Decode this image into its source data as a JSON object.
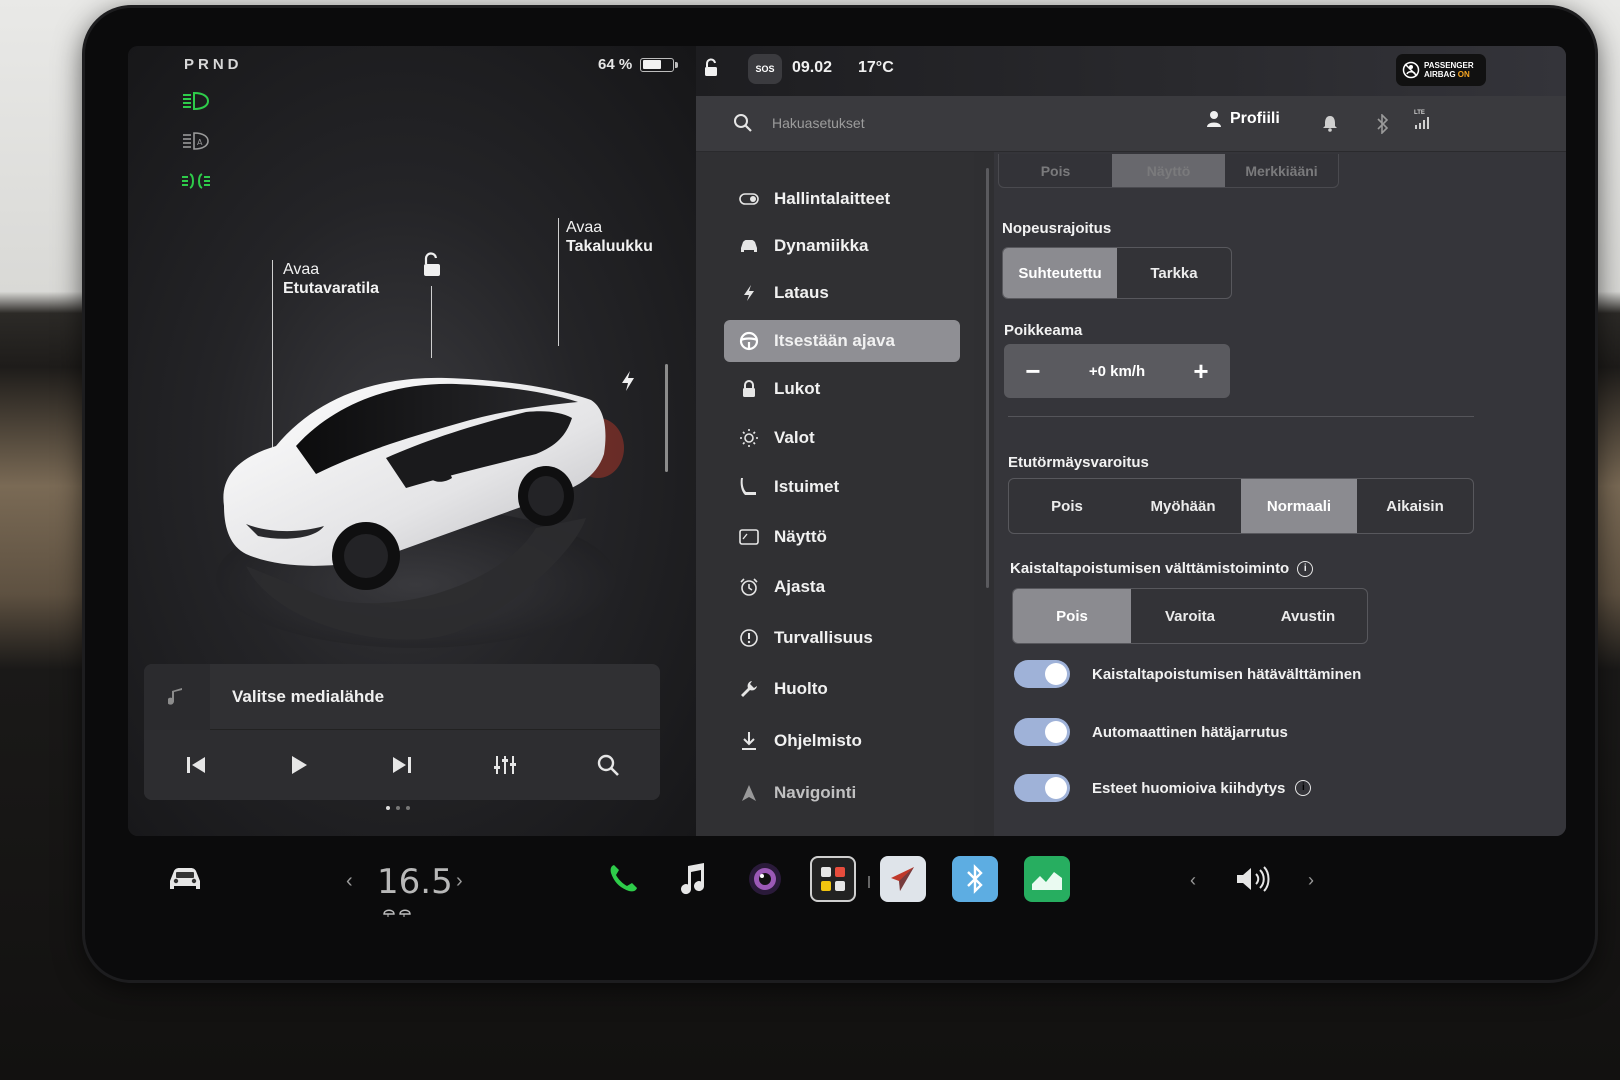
{
  "drive": {
    "gears": "PRND"
  },
  "battery": {
    "percent_label": "64 %",
    "level": 0.64
  },
  "callouts": {
    "front_trunk_line1": "Avaa",
    "front_trunk_line2": "Etutavaratila",
    "rear_trunk_line1": "Avaa",
    "rear_trunk_line2": "Takaluukku"
  },
  "media": {
    "source_label": "Valitse medialähde"
  },
  "status_bar": {
    "sos": "SOS",
    "time": "09.02",
    "temperature": "17°C",
    "airbag_line1": "PASSENGER",
    "airbag_line2_prefix": "AIRBAG",
    "airbag_line2_state": "ON",
    "lte": "LTE"
  },
  "search": {
    "placeholder": "Hakuasetukset"
  },
  "profile": {
    "label": "Profiili"
  },
  "menu": {
    "items": [
      {
        "label": "Hallintalaitteet",
        "icon": "toggle-icon"
      },
      {
        "label": "Dynamiikka",
        "icon": "car-icon"
      },
      {
        "label": "Lataus",
        "icon": "bolt-icon"
      },
      {
        "label": "Itsestään ajava",
        "icon": "steering-wheel-icon",
        "active": true
      },
      {
        "label": "Lukot",
        "icon": "lock-icon"
      },
      {
        "label": "Valot",
        "icon": "sun-icon"
      },
      {
        "label": "Istuimet",
        "icon": "seat-icon"
      },
      {
        "label": "Näyttö",
        "icon": "display-icon"
      },
      {
        "label": "Ajasta",
        "icon": "alarm-clock-icon"
      },
      {
        "label": "Turvallisuus",
        "icon": "alert-circle-icon"
      },
      {
        "label": "Huolto",
        "icon": "wrench-icon"
      },
      {
        "label": "Ohjelmisto",
        "icon": "download-icon"
      },
      {
        "label": "Navigointi",
        "icon": "navigation-icon"
      }
    ]
  },
  "settings": {
    "top_segment": [
      "Pois",
      "Näyttö",
      "Merkkiääni"
    ],
    "top_segment_selected": "Näyttö",
    "speed_limit": {
      "label": "Nopeusrajoitus",
      "options": [
        "Suhteutettu",
        "Tarkka"
      ],
      "selected": "Suhteutettu"
    },
    "offset": {
      "label": "Poikkeama",
      "value": "+0 km/h",
      "minus": "−",
      "plus": "+"
    },
    "forward_collision": {
      "label": "Etutörmäysvaroitus",
      "options": [
        "Pois",
        "Myöhään",
        "Normaali",
        "Aikaisin"
      ],
      "selected": "Normaali"
    },
    "lane_departure": {
      "label": "Kaistaltapoistumisen välttämistoiminto",
      "options": [
        "Pois",
        "Varoita",
        "Avustin"
      ],
      "selected": "Pois"
    },
    "toggles": [
      {
        "label": "Kaistaltapoistumisen hätävälttäminen",
        "on": true,
        "info": false
      },
      {
        "label": "Automaattinen hätäjarrutus",
        "on": true,
        "info": false
      },
      {
        "label": "Esteet huomioiva kiihdytys",
        "on": true,
        "info": true
      }
    ]
  },
  "dock": {
    "cabin_temp": "16.5",
    "apps": [
      "car-icon",
      "phone-icon",
      "music-icon",
      "camera-icon",
      "apps-launcher-icon",
      "navigation-icon",
      "bluetooth-icon",
      "energy-chart-icon",
      "volume-icon"
    ]
  },
  "colors": {
    "accent_green": "#2ecc4a",
    "selected_segment": "#8b8b90",
    "toggle_on": "#9fb2d8",
    "airbag_on": "#f6a623"
  }
}
